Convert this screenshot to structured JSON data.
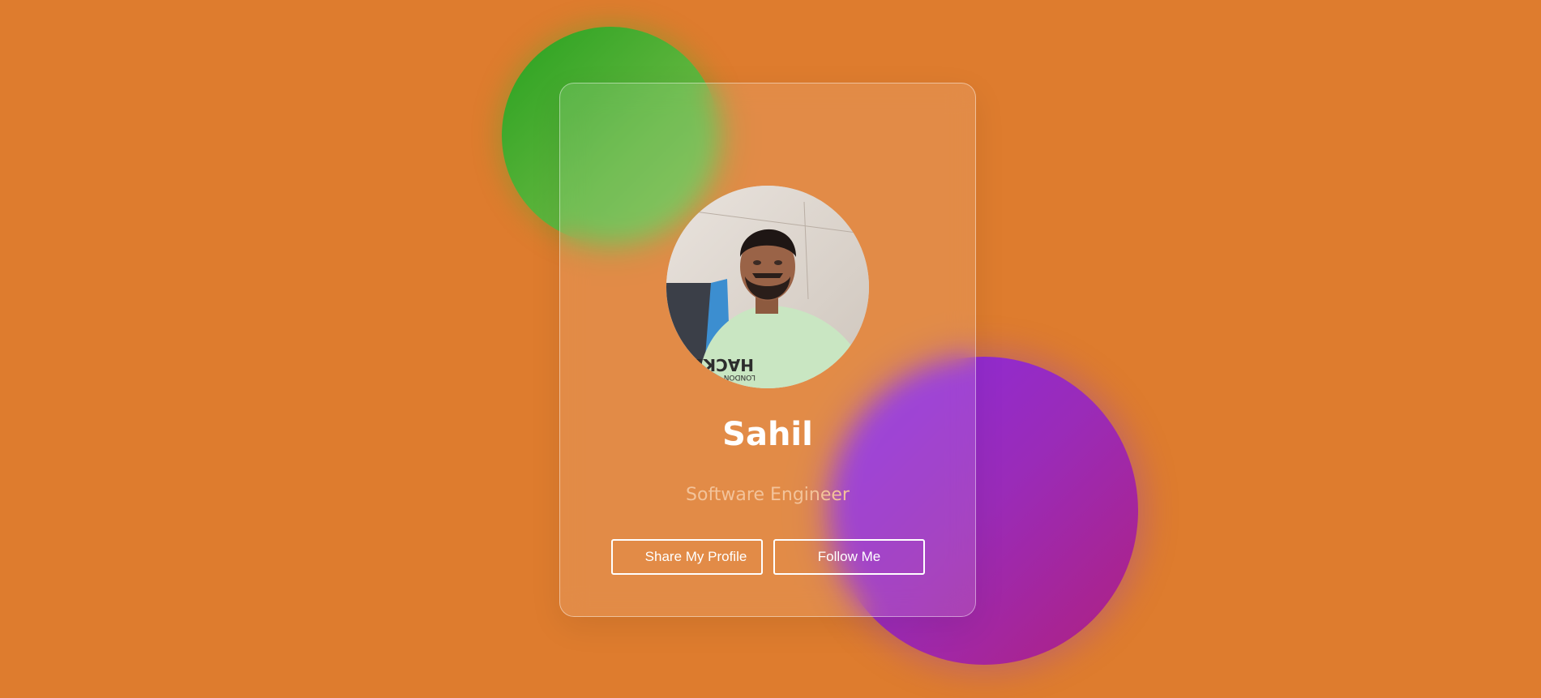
{
  "profile": {
    "name": "Sahil",
    "title": "Software Engineer"
  },
  "buttons": {
    "share_label": "Share My Profile",
    "follow_label": "Follow Me"
  },
  "avatar": {
    "shirt_text": "HACKER",
    "shirt_subtext": "LONDON"
  },
  "colors": {
    "background": "#de7c2e",
    "green_blob": "#3ea32a",
    "purple_blob": "#9a2bc0",
    "title_color": "#f3c39a"
  }
}
